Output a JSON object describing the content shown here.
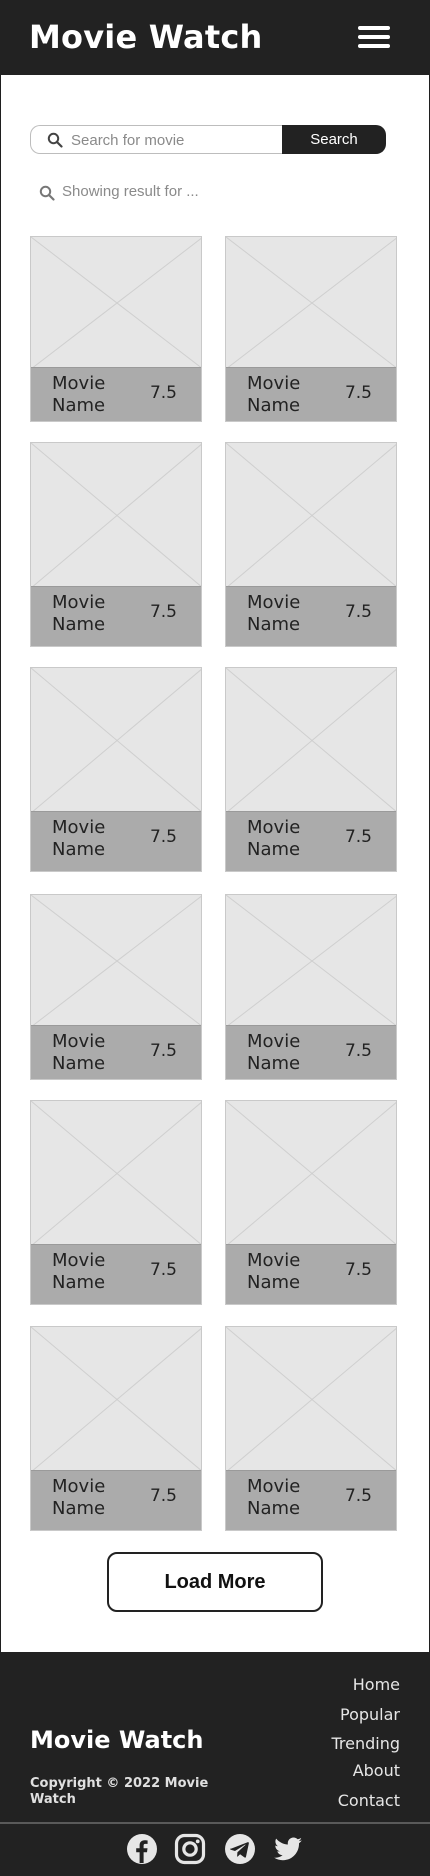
{
  "header": {
    "title": "Movie Watch",
    "menu_icon": "hamburger-menu-icon"
  },
  "search": {
    "placeholder": "Search for movie",
    "value": "",
    "button_label": "Search",
    "icon": "search-icon"
  },
  "result_text": "Showing result for ...",
  "movies": [
    {
      "name": "Movie Name",
      "rating": "7.5"
    },
    {
      "name": "Movie Name",
      "rating": "7.5"
    },
    {
      "name": "Movie Name",
      "rating": "7.5"
    },
    {
      "name": "Movie Name",
      "rating": "7.5"
    },
    {
      "name": "Movie Name",
      "rating": "7.5"
    },
    {
      "name": "Movie Name",
      "rating": "7.5"
    },
    {
      "name": "Movie Name",
      "rating": "7.5"
    },
    {
      "name": "Movie Name",
      "rating": "7.5"
    },
    {
      "name": "Movie Name",
      "rating": "7.5"
    },
    {
      "name": "Movie Name",
      "rating": "7.5"
    },
    {
      "name": "Movie Name",
      "rating": "7.5"
    },
    {
      "name": "Movie Name",
      "rating": "7.5"
    }
  ],
  "load_more_label": "Load More",
  "footer": {
    "brand": "Movie Watch",
    "copyright": "Copyright © 2022 Movie Watch",
    "links": [
      "Home",
      "Popular",
      "Trending",
      "About",
      "Contact"
    ],
    "social": [
      "facebook-icon",
      "instagram-icon",
      "telegram-icon",
      "twitter-icon"
    ]
  },
  "colors": {
    "dark": "#222222",
    "card_bg": "#e6e6e6",
    "card_bar": "#ababab",
    "page_bg": "#ffffff"
  }
}
